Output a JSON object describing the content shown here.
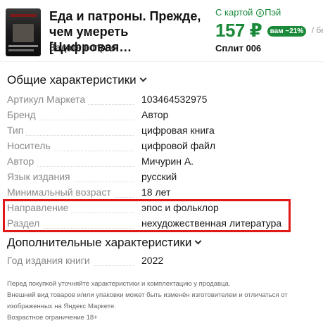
{
  "header": {
    "title": "Еда и патроны. Прежде, чем умереть [Цифровая…",
    "ask_question": "Задать вопрос",
    "with_card": "С картой",
    "pay_icon": "я",
    "pay_brand": "Пэй",
    "price": "157 ₽",
    "discount_badge": "вам −21%",
    "without_card": "/ без",
    "split": "Сплит 006"
  },
  "sections": {
    "general_title": "Общие характеристики",
    "additional_title": "Дополнительные характеристики"
  },
  "general_specs": [
    {
      "label": "Артикул Маркета",
      "value": "103464532975"
    },
    {
      "label": "Бренд",
      "value": "Автор"
    },
    {
      "label": "Тип",
      "value": "цифровая книга"
    },
    {
      "label": "Носитель",
      "value": "цифровой файл"
    },
    {
      "label": "Автор",
      "value": "Мичурин А."
    },
    {
      "label": "Язык издания",
      "value": "русский"
    },
    {
      "label": "Минимальный возраст",
      "value": "18 лет"
    },
    {
      "label": "Направление",
      "value": "эпос и фольклор"
    },
    {
      "label": "Раздел",
      "value": "нехудожественная литература"
    }
  ],
  "additional_specs": [
    {
      "label": "Год издания книги",
      "value": "2022"
    }
  ],
  "footnotes": [
    "Перед покупкой уточняйте характеристики и комплектацию у продавца.",
    "Внешний вид товаров и/или упаковки может быть изменён изготовителем и отличаться от",
    "изображенных на Яндекс Маркете.",
    "Возрастное ограничение 18+"
  ],
  "colors": {
    "price_green": "#1a8a3a",
    "highlight_red": "#e01818"
  }
}
